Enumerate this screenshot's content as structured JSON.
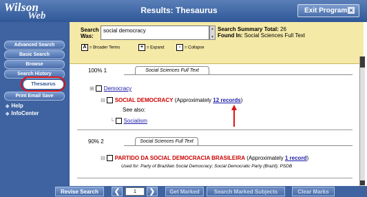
{
  "app": {
    "logo_line1": "Wilson",
    "logo_line2": "Web",
    "title": "Results: Thesaurus",
    "exit_button": "Exit Program",
    "exit_icon": "x-icon"
  },
  "sidebar": {
    "items": [
      {
        "label": "Advanced Search"
      },
      {
        "label": "Basic Search"
      },
      {
        "label": "Browse"
      },
      {
        "label": "Search History"
      },
      {
        "label": "Thesaurus"
      },
      {
        "label": "Print Email Save"
      }
    ],
    "active": "Thesaurus",
    "links": [
      {
        "label": "Help"
      },
      {
        "label": "InfoCenter"
      }
    ]
  },
  "search": {
    "label_line1": "Search",
    "label_line2": "Was:",
    "value": "social democracy",
    "summary_total_label": "Search Summary Total:",
    "summary_total_value": "26",
    "found_in_label": "Found In:",
    "found_in_value": "Social Sciences Full Text"
  },
  "legend": {
    "broader_symbol": "A",
    "broader": "= Broader Terms",
    "expand_symbol": "+",
    "expand": "= Expand",
    "collapse_symbol": "-",
    "collapse": "= Collapse"
  },
  "results": [
    {
      "rank": "100% 1",
      "tab": "Social Sciences Full Text",
      "broader_term": "Democracy",
      "term": "SOCIAL DEMOCRACY",
      "approx_prefix": "(Approximately",
      "records_link": "12 records",
      "approx_suffix": ")",
      "see_also_label": "See also:",
      "see_also_term": "Socialism"
    },
    {
      "rank": "90% 2",
      "tab": "Social Sciences Full Text",
      "term": "PARTIDO DA SOCIAL DEMOCRACIA BRASILEIRA",
      "approx_prefix": "(Approximately",
      "records_link": "1 record",
      "approx_suffix": ")",
      "used_for": "Used for: Party of Brazilian Social Democracy; Social Democratic Party (Brazil); PSDB"
    }
  ],
  "bottom": {
    "revise": "Revise Search",
    "prev_icon": "chevron-left-icon",
    "page": "1",
    "next_icon": "chevron-right-icon",
    "get_marked": "Get Marked",
    "search_marked": "Search Marked Subjects",
    "clear_marks": "Clear Marks"
  },
  "colors": {
    "header_blue": "#2f5797",
    "search_panel_yellow": "#f5e9a8",
    "term_red": "#cc0000",
    "link_blue": "#1a1aa8",
    "highlight_red": "#e01010"
  }
}
